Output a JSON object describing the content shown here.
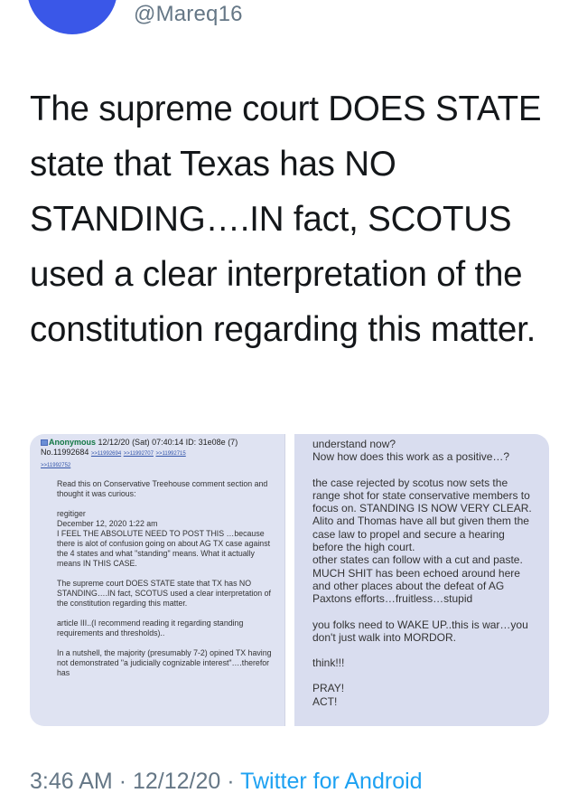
{
  "header": {
    "handle": "@Mareq16"
  },
  "tweet": {
    "text": "The supreme court DOES STATE state that Texas has NO STANDING….IN fact, SCOTUS used a clear interpretation of the constitution regarding this matter."
  },
  "media": {
    "left_post": {
      "name": "Anonymous",
      "datetime": "12/12/20 (Sat) 07:40:14",
      "id": "ID: 31e08e",
      "id_count": "(7)",
      "post_no": "No.11992684",
      "replies": [
        ">>11992694",
        ">>11992707",
        ">>11992715"
      ],
      "replies_extra": ">>11992752",
      "paragraphs": [
        "Read this on Conservative Treehouse comment section and thought it was curious:",
        "regitiger\n December 12, 2020 1:22 am\nI FEEL THE ABSOLUTE NEED TO POST THIS …because there is alot of confusion going on about AG TX case against the 4 states and what \"standing\" means. What it actually means IN THIS CASE.",
        "The supreme court DOES STATE state that TX has NO STANDING….IN fact, SCOTUS used a clear interpretation of the constitution regarding this matter.",
        "article III..(I recommend reading it regarding standing requirements and thresholds)..",
        "In a nutshell, the majority (presumably 7-2) opined TX having not demonstrated \"a judicially cognizable interest\"….therefor has"
      ]
    },
    "right_post": {
      "paragraphs": [
        "understand now?\nNow how does this work as a positive…?",
        "the case rejected by scotus now sets the range shot for state conservative members to focus on. STANDING IS NOW VERY CLEAR. Alito and Thomas have all but given them the case law to propel and secure a hearing before the high court.\nother states can follow with a cut and paste.\nMUCH SHIT has been echoed around here and other places about the defeat of AG Paxtons efforts…fruitless…stupid",
        "you folks need to WAKE UP..this is war…you don't just walk into MORDOR.",
        "think!!!",
        "PRAY!\nACT!"
      ]
    }
  },
  "footer": {
    "time": "3:46 AM",
    "date": "12/12/20",
    "separator": "·",
    "client": "Twitter for Android"
  },
  "colors": {
    "link": "#1da1f2",
    "muted": "#657786",
    "panel_bg": "#dfe3f2",
    "anon_name": "#117743"
  }
}
